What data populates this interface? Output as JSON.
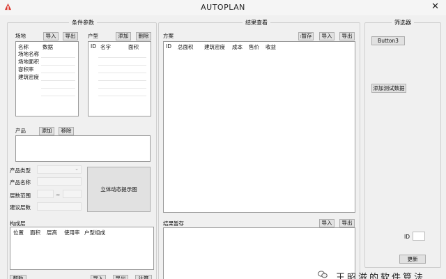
{
  "window": {
    "title": "AUTOPLAN",
    "close_glyph": "✕",
    "app_icon": "app-logo-icon"
  },
  "conditions": {
    "title": "条件参数",
    "site": {
      "label": "场地",
      "import": "导入",
      "export": "导出",
      "headers": [
        "名称",
        "数据"
      ],
      "rows": [
        "场地名称",
        "场地面积",
        "容积率",
        "建筑密度"
      ]
    },
    "unit": {
      "label": "户型",
      "add": "添加",
      "delete": "删除",
      "headers": [
        "ID",
        "名字",
        "面积"
      ]
    },
    "product": {
      "label": "产品",
      "add": "添加",
      "delete": "移除"
    },
    "form": {
      "type_label": "产品类型",
      "name_label": "产品名称",
      "floor_range_label": "层数范围",
      "floor_range_sep": "~",
      "suggest_label": "建议层数",
      "preview_button": "立体动态提示图"
    },
    "composition": {
      "label": "构成层",
      "headers": [
        "位置",
        "面积",
        "层高",
        "使用率",
        "户型组成"
      ]
    },
    "bottom_buttons": [
      "帮助",
      "导入",
      "导出",
      "计算"
    ]
  },
  "results": {
    "title": "结果查看",
    "plans": {
      "label": "方案",
      "pause": "暂存",
      "import": "导入",
      "export": "导出",
      "headers": [
        "ID",
        "总面积",
        "建筑密度",
        "成本",
        "售价",
        "收益"
      ]
    },
    "temp": {
      "label": "结果暂存",
      "import": "导入",
      "export": "导出"
    }
  },
  "filter": {
    "title": "筛选器",
    "button3": "Button3",
    "add_test": "添加测试数据",
    "id_label": "ID",
    "refresh": "更新"
  },
  "watermark": {
    "text": "王昭滋的软件算法"
  }
}
